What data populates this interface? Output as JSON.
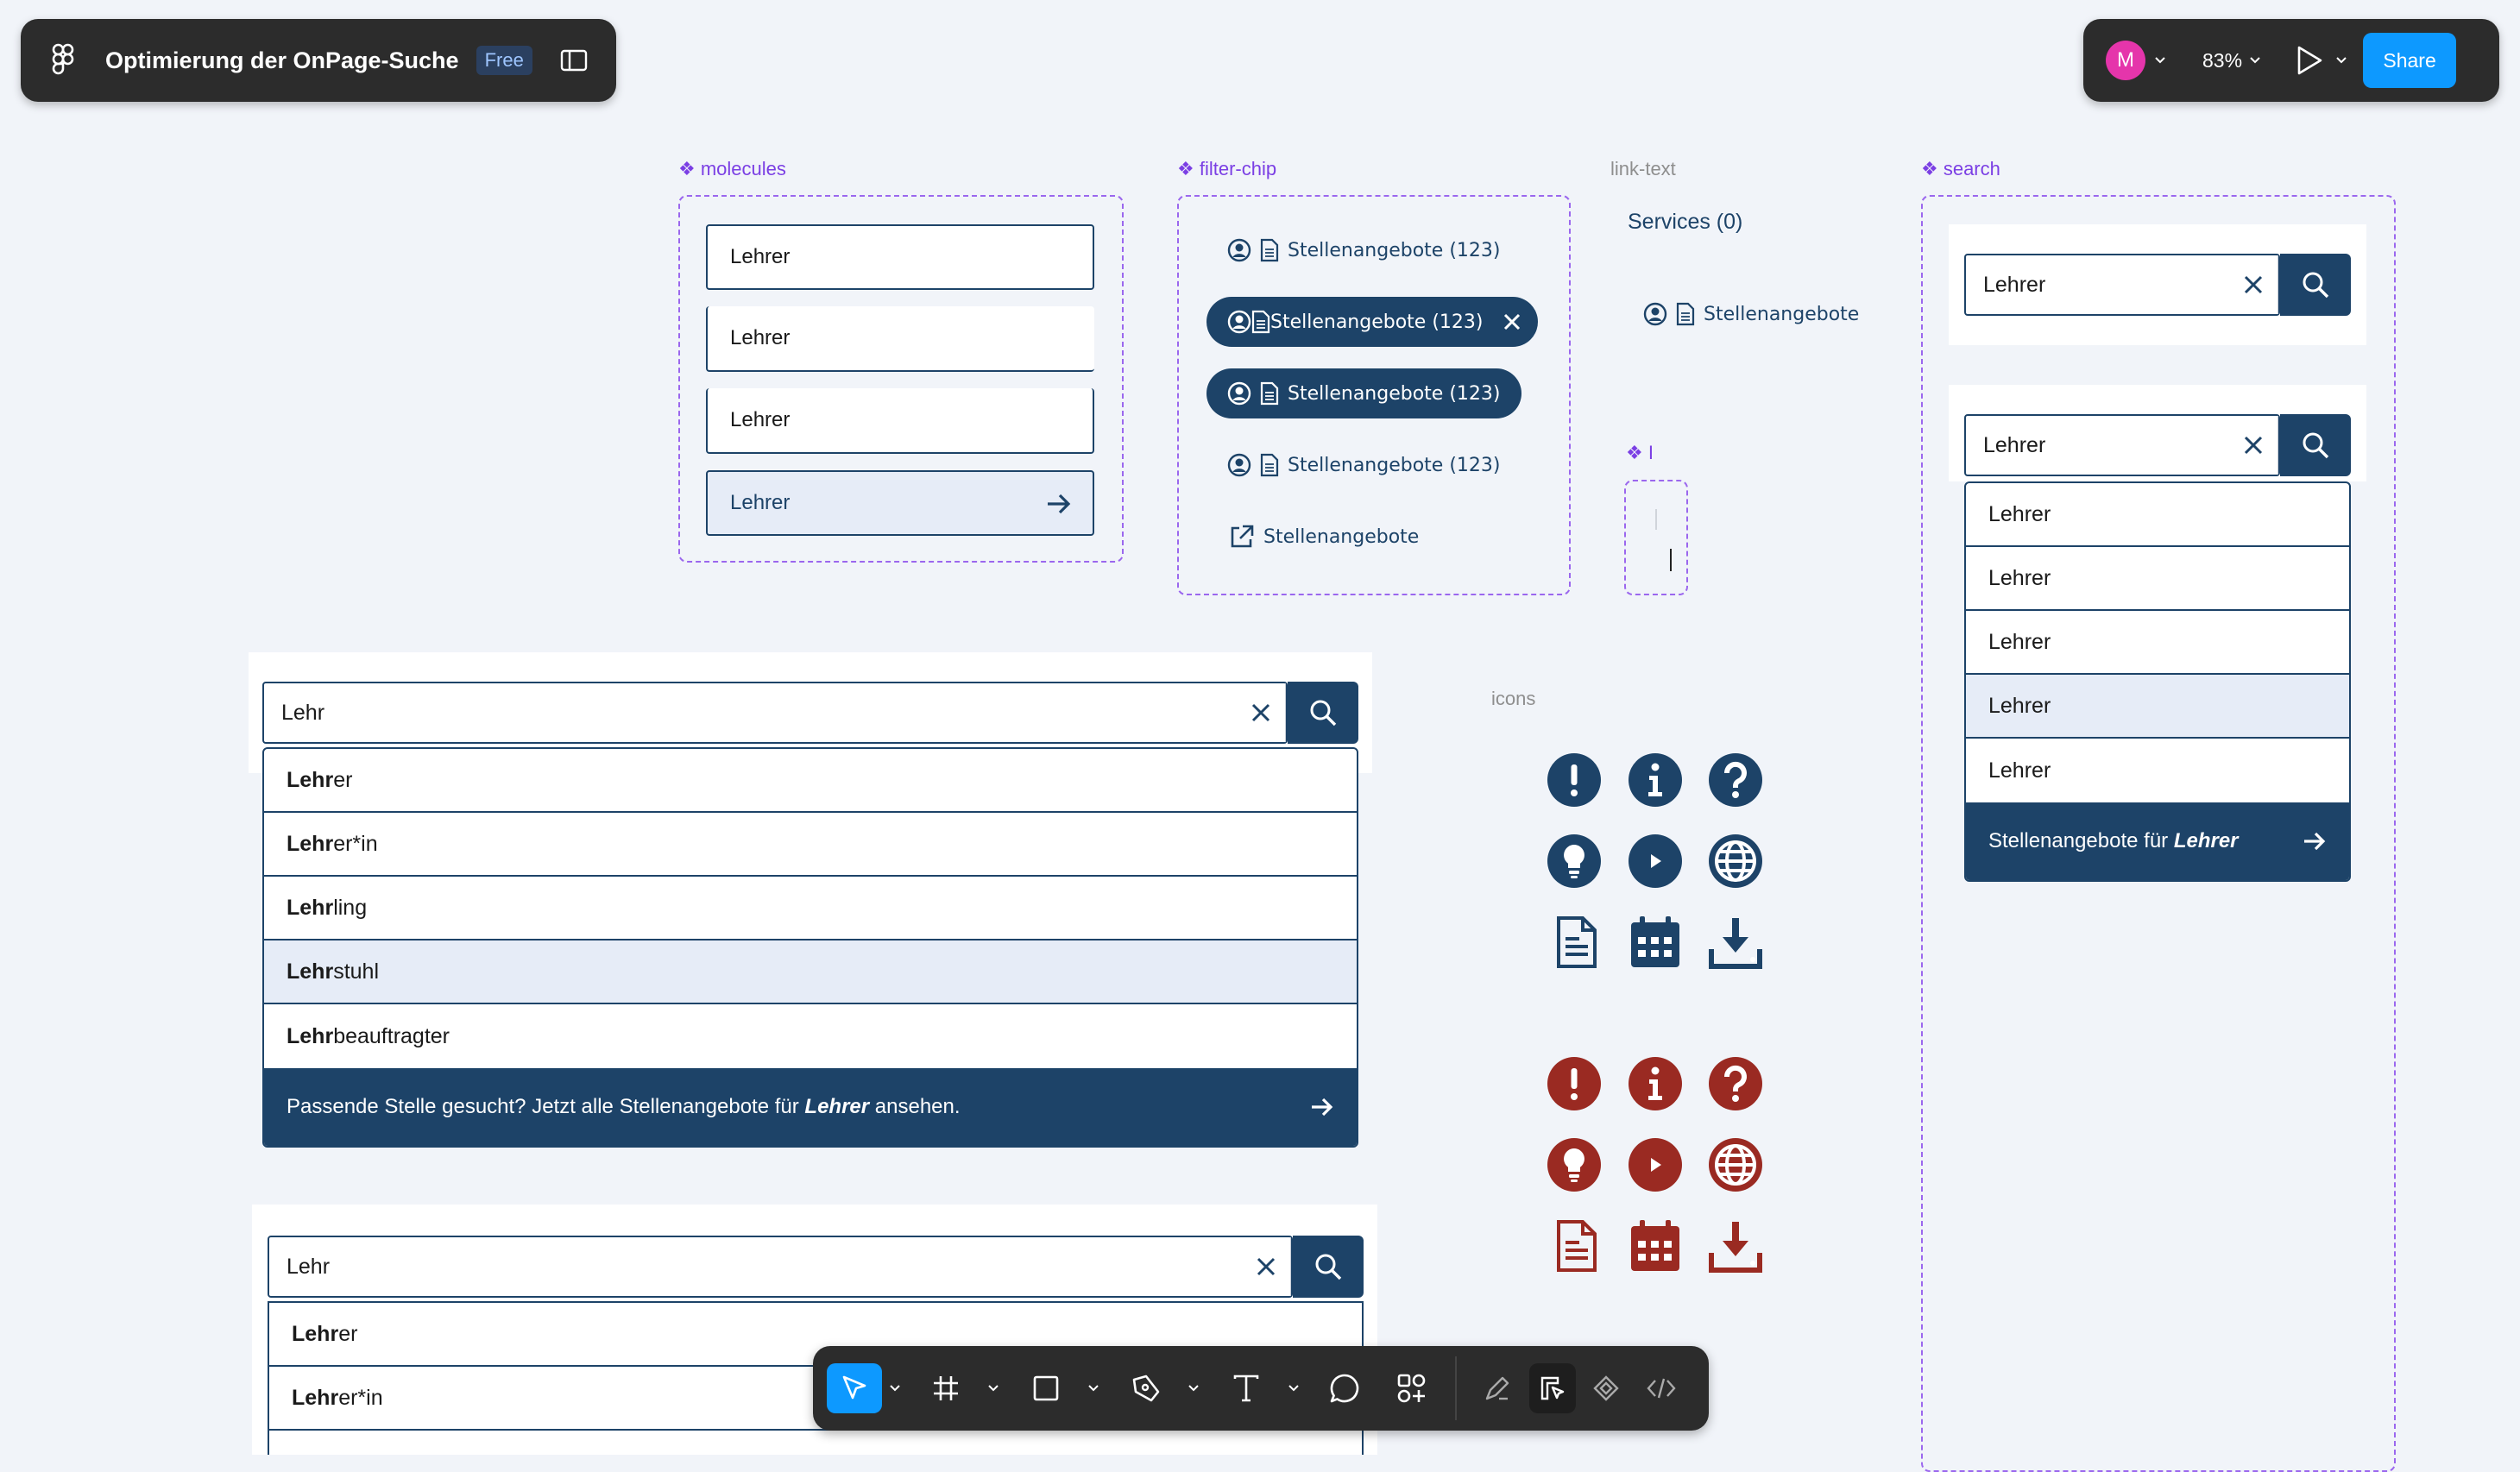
{
  "header": {
    "doc_title": "Optimierung der OnPage-Suche",
    "plan_badge": "Free",
    "user_initial": "M",
    "zoom": "83%",
    "share_label": "Share"
  },
  "sections": {
    "molecules": "❖ molecules",
    "filter_chip": "❖ filter-chip",
    "link_text": "link-text",
    "search": "❖ search",
    "icons": "icons",
    "cursor": "❖ I"
  },
  "molecules": [
    "Lehrer",
    "Lehrer",
    "Lehrer",
    "Lehrer"
  ],
  "chips": {
    "label": "Stellenangebote",
    "count": "(123)",
    "link_label": "Stellenangebote"
  },
  "link_text": {
    "services": "Services (0)",
    "item": "Stellenangebote"
  },
  "search_big": {
    "value": "Lehr",
    "suggestions": [
      {
        "bold": "Lehr",
        "rest": "er"
      },
      {
        "bold": "Lehr",
        "rest": "er*in"
      },
      {
        "bold": "Lehr",
        "rest": "ling"
      },
      {
        "bold": "Lehr",
        "rest": "stuhl"
      },
      {
        "bold": "Lehr",
        "rest": "beauftragter"
      }
    ],
    "footer_pre": "Passende Stelle gesucht? Jetzt alle Stellenangebote für ",
    "footer_term": "Lehrer",
    "footer_post": " ansehen."
  },
  "search_small": {
    "value": "Lehr",
    "suggestions": [
      {
        "bold": "Lehr",
        "rest": "er"
      },
      {
        "bold": "Lehr",
        "rest": "er*in"
      }
    ]
  },
  "search_right": {
    "value1": "Lehrer",
    "value2": "Lehrer",
    "items": [
      "Lehrer",
      "Lehrer",
      "Lehrer",
      "Lehrer",
      "Lehrer"
    ],
    "footer_pre": "Stellenangebote für ",
    "footer_term": "Lehrer"
  },
  "colors": {
    "primary": "#1d4368",
    "danger": "#9a2a22",
    "accent": "#0d99ff",
    "component": "#7b3fe4"
  },
  "toolbar": {
    "tools": [
      "move-tool",
      "frame-tool",
      "shape-tool",
      "pen-tool",
      "text-tool",
      "comment-tool",
      "actions-tool",
      "draw-mode",
      "design-mode",
      "prototype-mode",
      "dev-mode"
    ]
  }
}
